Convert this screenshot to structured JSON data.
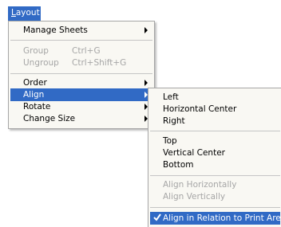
{
  "menubar": {
    "layout_prefix": "L",
    "layout_rest": "ayout"
  },
  "main_menu": {
    "items": [
      {
        "label": "Manage Sheets",
        "shortcut": "",
        "submenu": true,
        "disabled": false
      },
      {
        "label": "Group",
        "shortcut": "Ctrl+G",
        "submenu": false,
        "disabled": true
      },
      {
        "label": "Ungroup",
        "shortcut": "Ctrl+Shift+G",
        "submenu": false,
        "disabled": true
      },
      {
        "label": "Order",
        "shortcut": "",
        "submenu": true,
        "disabled": false
      },
      {
        "label": "Align",
        "shortcut": "",
        "submenu": true,
        "disabled": false,
        "highlighted": true
      },
      {
        "label": "Rotate",
        "shortcut": "",
        "submenu": true,
        "disabled": false
      },
      {
        "label": "Change Size",
        "shortcut": "",
        "submenu": true,
        "disabled": false
      }
    ]
  },
  "align_submenu": {
    "items": [
      {
        "label": "Left",
        "disabled": false
      },
      {
        "label": "Horizontal Center",
        "disabled": false
      },
      {
        "label": "Right",
        "disabled": false
      },
      {
        "label": "Top",
        "disabled": false
      },
      {
        "label": "Vertical Center",
        "disabled": false
      },
      {
        "label": "Bottom",
        "disabled": false
      },
      {
        "label": "Align Horizontally",
        "disabled": true
      },
      {
        "label": "Align Vertically",
        "disabled": true
      },
      {
        "label": "Align in Relation to Print Area",
        "disabled": false,
        "checked": true,
        "highlighted": true
      }
    ]
  },
  "colors": {
    "highlight": "#316ac5",
    "menu_bg": "#f9f8f3",
    "disabled_text": "#a6a6a6"
  }
}
